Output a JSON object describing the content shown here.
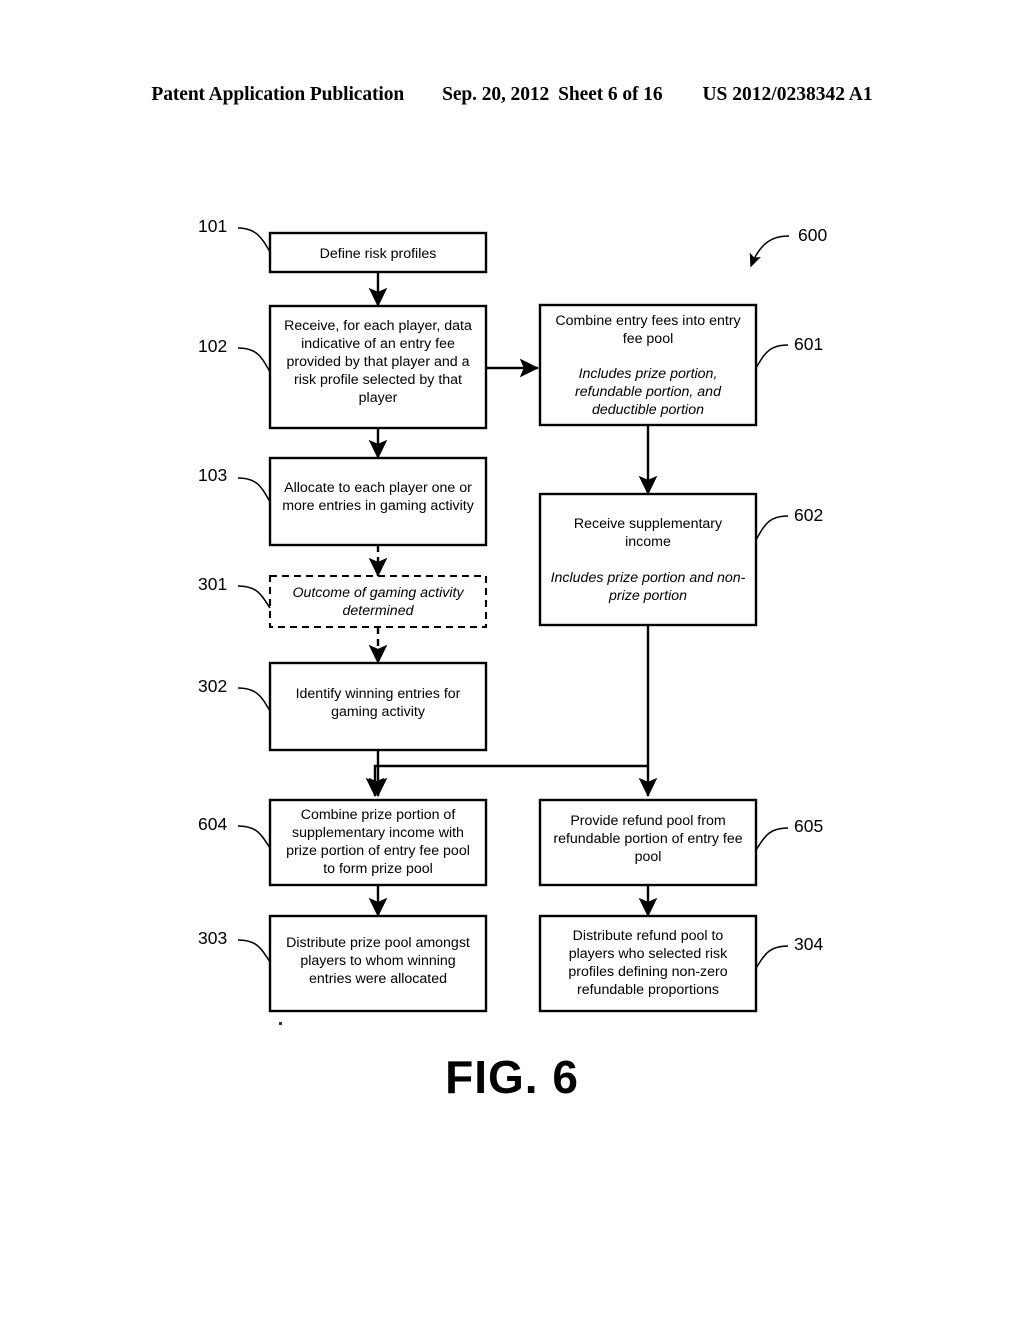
{
  "header": {
    "publication": "Patent Application Publication",
    "date": "Sep. 20, 2012",
    "sheet": "Sheet 6 of 16",
    "patent_number": "US 2012/0238342 A1"
  },
  "figure": {
    "caption": "FIG. 6",
    "diagram_label": "600"
  },
  "nodes": [
    {
      "ref": "101",
      "name": "define-risk-profiles",
      "style": "solid",
      "lines": [
        {
          "text": "Define risk profiles",
          "italic": false
        }
      ]
    },
    {
      "ref": "102",
      "name": "receive-player-data",
      "style": "solid",
      "lines": [
        {
          "text": "Receive, for each player, data",
          "italic": false
        },
        {
          "text": "indicative of an entry fee",
          "italic": false
        },
        {
          "text": "provided by that player and a",
          "italic": false
        },
        {
          "text": "risk profile selected by that",
          "italic": false
        },
        {
          "text": "player",
          "italic": false
        }
      ]
    },
    {
      "ref": "103",
      "name": "allocate-entries",
      "style": "solid",
      "lines": [
        {
          "text": "Allocate to each player one or",
          "italic": false
        },
        {
          "text": "more entries in gaming activity",
          "italic": false
        }
      ]
    },
    {
      "ref": "301",
      "name": "outcome-determined",
      "style": "dashed",
      "lines": [
        {
          "text": "Outcome of gaming activity",
          "italic": true
        },
        {
          "text": "determined",
          "italic": true
        }
      ]
    },
    {
      "ref": "302",
      "name": "identify-winning-entries",
      "style": "solid",
      "lines": [
        {
          "text": "Identify winning entries for",
          "italic": false
        },
        {
          "text": "gaming activity",
          "italic": false
        }
      ]
    },
    {
      "ref": "601",
      "name": "combine-entry-fees",
      "style": "solid",
      "lines": [
        {
          "text": "Combine entry fees into entry",
          "italic": false
        },
        {
          "text": "fee pool",
          "italic": false
        },
        {
          "text": "",
          "italic": false
        },
        {
          "text": "Includes prize portion,",
          "italic": true
        },
        {
          "text": "refundable portion, and",
          "italic": true
        },
        {
          "text": "deductible portion",
          "italic": true
        }
      ]
    },
    {
      "ref": "602",
      "name": "receive-supplementary-income",
      "style": "solid",
      "lines": [
        {
          "text": "Receive supplementary",
          "italic": false
        },
        {
          "text": "income",
          "italic": false
        },
        {
          "text": "",
          "italic": false
        },
        {
          "text": "Includes prize portion and non-",
          "italic": true
        },
        {
          "text": "prize portion",
          "italic": true
        }
      ]
    },
    {
      "ref": "604",
      "name": "combine-prize-portions",
      "style": "solid",
      "lines": [
        {
          "text": "Combine prize portion of",
          "italic": false
        },
        {
          "text": "supplementary income with",
          "italic": false
        },
        {
          "text": "prize portion of entry fee pool",
          "italic": false
        },
        {
          "text": "to form prize pool",
          "italic": false
        }
      ]
    },
    {
      "ref": "605",
      "name": "provide-refund-pool",
      "style": "solid",
      "lines": [
        {
          "text": "Provide refund pool from",
          "italic": false
        },
        {
          "text": "refundable portion of entry fee",
          "italic": false
        },
        {
          "text": "pool",
          "italic": false
        }
      ]
    },
    {
      "ref": "303",
      "name": "distribute-prize-pool",
      "style": "solid",
      "lines": [
        {
          "text": "Distribute prize pool amongst",
          "italic": false
        },
        {
          "text": "players to whom winning",
          "italic": false
        },
        {
          "text": "entries were allocated",
          "italic": false
        }
      ]
    },
    {
      "ref": "304",
      "name": "distribute-refund-pool",
      "style": "solid",
      "lines": [
        {
          "text": "Distribute refund pool to",
          "italic": false
        },
        {
          "text": "players who selected risk",
          "italic": false
        },
        {
          "text": "profiles defining non-zero",
          "italic": false
        },
        {
          "text": "refundable proportions",
          "italic": false
        }
      ]
    }
  ],
  "flow_edges": [
    {
      "from": "101",
      "to": "102",
      "style": "solid"
    },
    {
      "from": "102",
      "to": "103",
      "style": "solid"
    },
    {
      "from": "102",
      "to": "601",
      "style": "solid"
    },
    {
      "from": "103",
      "to": "301",
      "style": "dashed"
    },
    {
      "from": "301",
      "to": "302",
      "style": "dashed"
    },
    {
      "from": "601",
      "to": "602",
      "style": "solid"
    },
    {
      "from": "302",
      "to": "604",
      "style": "solid"
    },
    {
      "from": "602",
      "to": "604",
      "style": "solid"
    },
    {
      "from": "602",
      "to": "605",
      "style": "solid"
    },
    {
      "from": "604",
      "to": "303",
      "style": "solid"
    },
    {
      "from": "605",
      "to": "304",
      "style": "solid"
    }
  ]
}
